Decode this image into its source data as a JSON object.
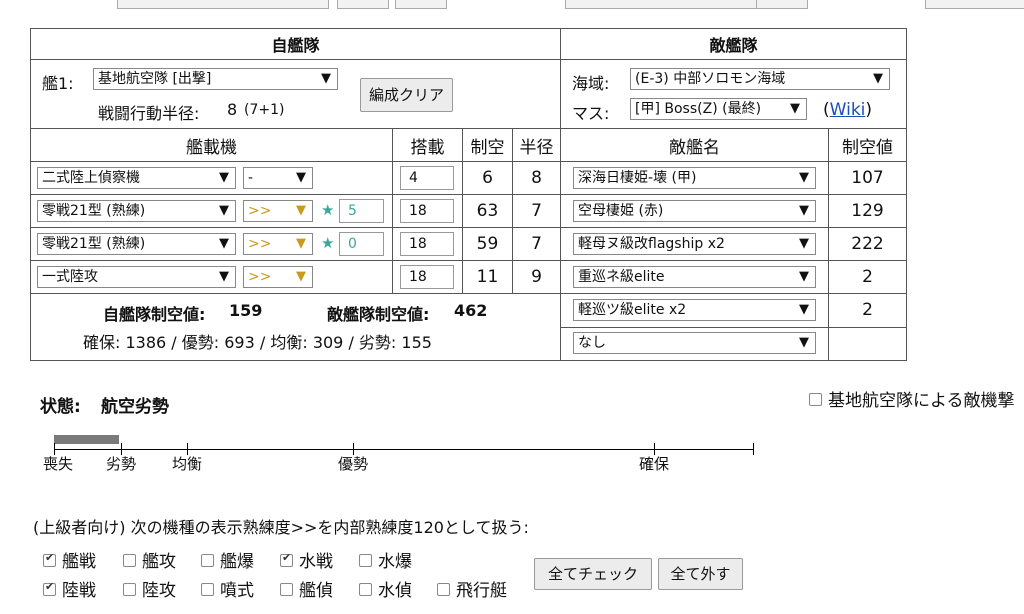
{
  "friendly_header": "自艦隊",
  "enemy_header": "敵艦隊",
  "fleet_label": "艦1:",
  "fleet_select": "基地航空隊 [出撃]",
  "radius_label": "戦闘行動半径:",
  "radius_value": "8",
  "radius_detail": "(7+1)",
  "clear_button": "編成クリア",
  "area_label": "海域:",
  "area_select": "(E-3) 中部ソロモン海域",
  "node_label": "マス:",
  "node_select": "[甲] Boss(Z) (最終)",
  "wiki_link": "Wiki",
  "paren_open": "(",
  "paren_close": ")",
  "col_aircraft": "艦載機",
  "col_slots": "搭載",
  "col_ap": "制空",
  "col_radius": "半径",
  "col_enemy": "敵艦名",
  "col_enemy_ap": "制空値",
  "aircraft": [
    {
      "name": "二式陸上偵察機",
      "prof": "-",
      "star": "",
      "slots": "4",
      "ap": "6",
      "radius": "8"
    },
    {
      "name": "零戦21型 (熟練)",
      "prof": ">>",
      "star": "5",
      "slots": "18",
      "ap": "63",
      "radius": "7"
    },
    {
      "name": "零戦21型 (熟練)",
      "prof": ">>",
      "star": "0",
      "slots": "18",
      "ap": "59",
      "radius": "7"
    },
    {
      "name": "一式陸攻",
      "prof": ">>",
      "star": "",
      "slots": "18",
      "ap": "11",
      "radius": "9"
    }
  ],
  "enemies": [
    {
      "name": "深海日棲姫-壊 (甲)",
      "ap": "107"
    },
    {
      "name": "空母棲姫 (赤)",
      "ap": "129"
    },
    {
      "name": "軽母ヌ級改flagship x2",
      "ap": "222"
    },
    {
      "name": "重巡ネ級elite",
      "ap": "2"
    },
    {
      "name": "軽巡ツ級elite x2",
      "ap": "2"
    },
    {
      "name": "なし",
      "ap": ""
    }
  ],
  "friendly_ap_label": "自艦隊制空値:",
  "friendly_ap_value": "159",
  "enemy_ap_label": "敵艦隊制空値:",
  "enemy_ap_value": "462",
  "thresholds": "確保: 1386 / 優勢: 693 / 均衡: 309 / 劣勢: 155",
  "status_label": "状態:",
  "status_value": "航空劣勢",
  "lbas_check_label": "基地航空隊による敵機撃",
  "scale": {
    "loss": "喪失",
    "inferior": "劣勢",
    "parity": "均衡",
    "superiority": "優勢",
    "supremacy": "確保",
    "fill_fraction": 0.093
  },
  "advanced_note": "(上級者向け) 次の機種の表示熟練度>>を内部熟練度120として扱う:",
  "types_row1": [
    {
      "label": "艦戦",
      "checked": true
    },
    {
      "label": "艦攻",
      "checked": false
    },
    {
      "label": "艦爆",
      "checked": false
    },
    {
      "label": "水戦",
      "checked": true
    },
    {
      "label": "水爆",
      "checked": false
    }
  ],
  "types_row2": [
    {
      "label": "陸戦",
      "checked": true
    },
    {
      "label": "陸攻",
      "checked": false
    },
    {
      "label": "噴式",
      "checked": false
    },
    {
      "label": "艦偵",
      "checked": false
    },
    {
      "label": "水偵",
      "checked": false
    },
    {
      "label": "飛行艇",
      "checked": false
    }
  ],
  "check_all_button": "全てチェック",
  "uncheck_all_button": "全て外す",
  "colors": {
    "star": "#3aa79b",
    "prof": "#c89a1e",
    "bar": "#7a7a7a",
    "link": "#1a4fb8"
  }
}
